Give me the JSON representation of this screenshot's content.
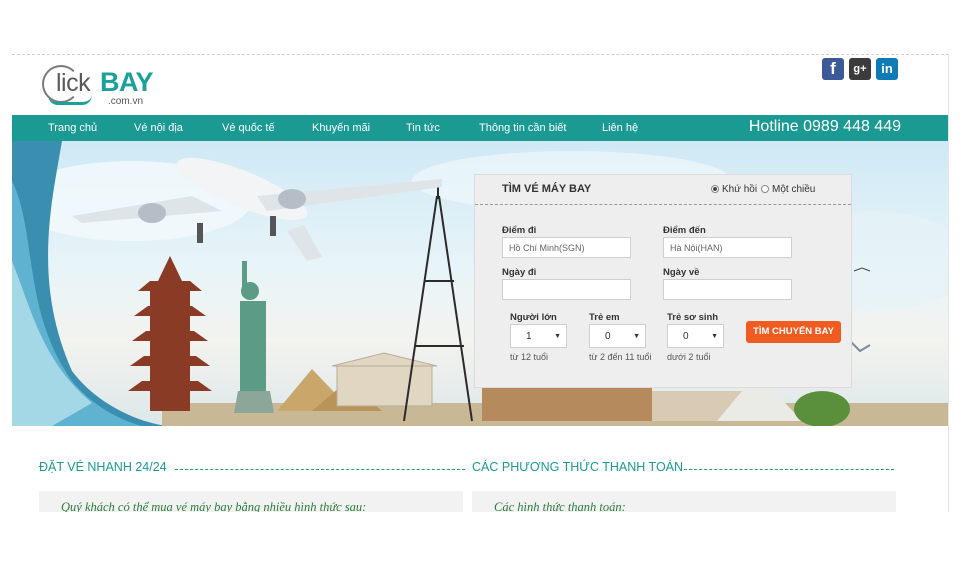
{
  "logo": {
    "lick": "lick",
    "bay": "BAY",
    "domain": ".com.vn"
  },
  "social": {
    "facebook": "f",
    "googleplus": "g+",
    "linkedin": "in"
  },
  "nav": {
    "items": [
      "Trang chủ",
      "Vé nội địa",
      "Vé quốc tế",
      "Khuyến mãi",
      "Tin tức",
      "Thông tin cần biết",
      "Liên hệ"
    ],
    "hotline": "Hotline 0989 448 449"
  },
  "search": {
    "title": "TÌM VÉ MÁY BAY",
    "trip_round": "Khứ hồi",
    "trip_oneway": "Một chiều",
    "from_label": "Điểm đi",
    "from_value": "Hồ Chí Minh(SGN)",
    "to_label": "Điểm đến",
    "to_value": "Hà Nội(HAN)",
    "depart_label": "Ngày đi",
    "depart_value": "",
    "return_label": "Ngày về",
    "return_value": "",
    "adult_label": "Người lớn",
    "adult_value": "1",
    "adult_hint": "từ 12 tuổi",
    "child_label": "Trẻ em",
    "child_value": "0",
    "child_hint": "từ 2 đến 11 tuổi",
    "infant_label": "Trẻ sơ sinh",
    "infant_value": "0",
    "infant_hint": "dưới 2 tuổi",
    "button": "TÌM CHUYẾN BAY"
  },
  "sections": {
    "left_title": "ĐẶT VÉ NHANH 24/24",
    "left_text": "Quý khách có thể mua vé máy bay bằng nhiều hình thức sau:",
    "right_title": "CÁC PHƯƠNG THỨC THANH TOÁN",
    "right_text": "Các hình thức thanh toán:"
  },
  "colors": {
    "brand_teal": "#1a9a93",
    "search_button": "#ef5b20"
  }
}
